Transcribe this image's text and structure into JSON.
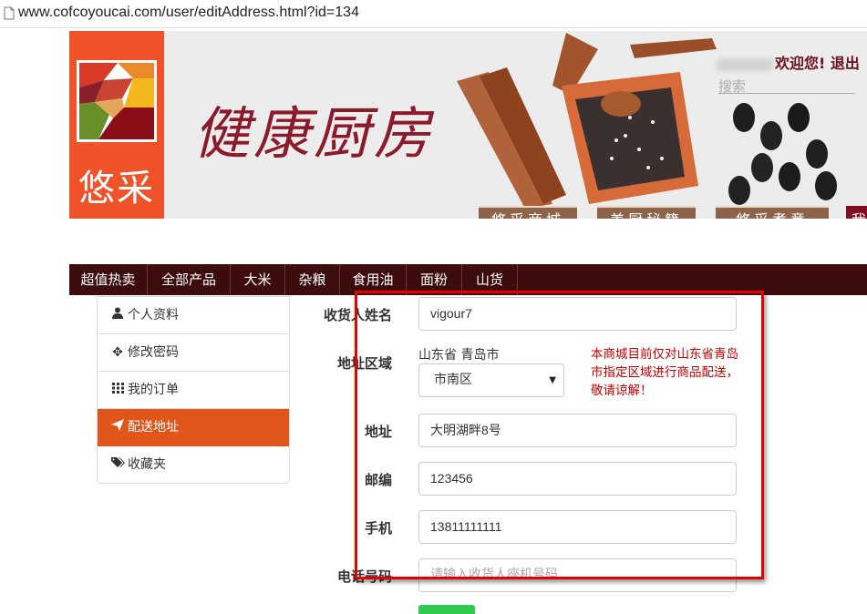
{
  "browser": {
    "url": "www.cofcoyoucai.com/user/editAddress.html?id=134"
  },
  "header": {
    "logo_text": "悠采",
    "brand_title": "健康厨房",
    "welcome_text": "欢迎您!",
    "logout_label": "退出",
    "search_hint": "搜索",
    "tabs": [
      "悠采商城",
      "美厨秘籍",
      "悠采煮意",
      "我"
    ]
  },
  "nav": {
    "items": [
      "超值热卖",
      "全部产品",
      "大米",
      "杂粮",
      "食用油",
      "面粉",
      "山货"
    ]
  },
  "sidebar": {
    "items": [
      {
        "label": "个人资料",
        "icon": "user-icon"
      },
      {
        "label": "修改密码",
        "icon": "move-icon"
      },
      {
        "label": "我的订单",
        "icon": "grid-icon"
      },
      {
        "label": "配送地址",
        "icon": "send-icon"
      },
      {
        "label": "收藏夹",
        "icon": "tags-icon"
      }
    ],
    "active_index": 3
  },
  "form": {
    "name_label": "收货人姓名",
    "name_value": "vigour7",
    "region_label": "地址区域",
    "region_text": "山东省 青岛市",
    "district_value": "市南区",
    "delivery_note": "本商城目前仅对山东省青岛市指定区域进行商品配送，敬请谅解！",
    "address_label": "地址",
    "address_value": "大明湖畔8号",
    "postcode_label": "邮编",
    "postcode_value": "123456",
    "mobile_label": "手机",
    "mobile_value": "13811111111",
    "phone_label": "电话号码",
    "phone_placeholder": "请输入收货人座机号码"
  },
  "colors": {
    "logo_bg": "#f0522a",
    "nav_bg": "#3d0d0d",
    "active_item": "#e05519",
    "note_red": "#cc0000",
    "annotation_red": "#e60000",
    "submit_green": "#2ecc4e"
  }
}
